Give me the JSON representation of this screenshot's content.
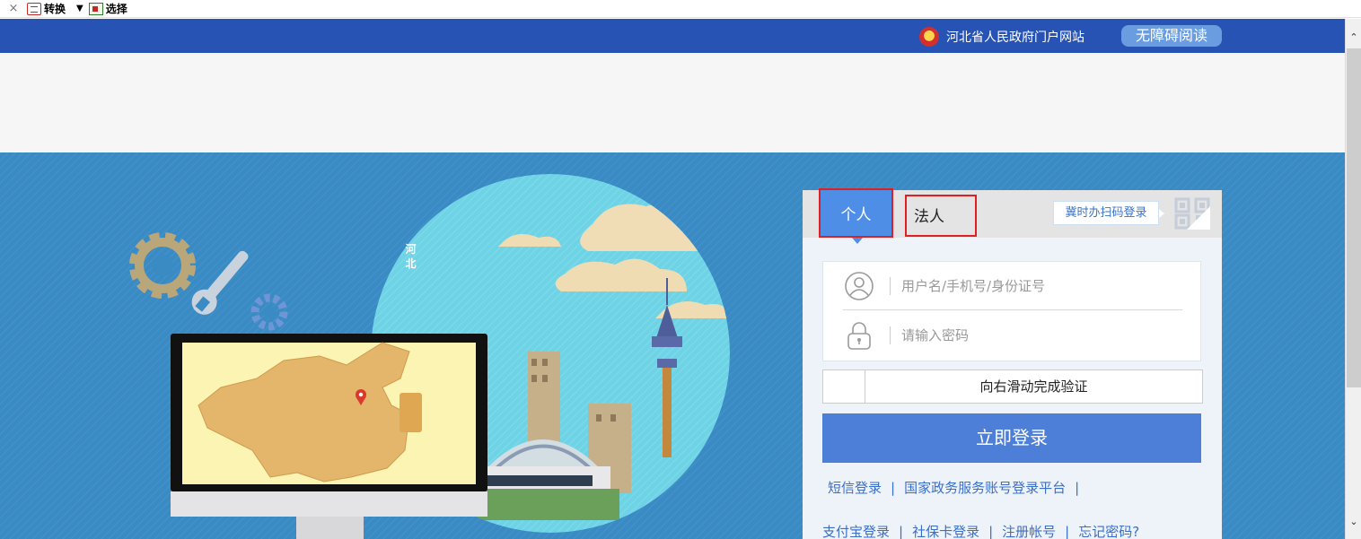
{
  "toolbar": {
    "close": "×",
    "convert_label": "转换",
    "dropdown": "▼",
    "select_label": "选择"
  },
  "header": {
    "gov_portal": "河北省人民政府门户网站",
    "accessible_read": "无障碍阅读"
  },
  "login": {
    "tab_personal": "个人",
    "tab_legal": "法人",
    "scan_login": "冀时办扫码登录",
    "username_placeholder": "用户名/手机号/身份证号",
    "password_placeholder": "请输入密码",
    "slider_text": "向右滑动完成验证",
    "login_button": "立即登录",
    "links_row1": [
      "短信登录",
      "国家政务服务账号登录平台"
    ],
    "links_row2": [
      "支付宝登录",
      "社保卡登录",
      "注册帐号",
      "忘记密码?"
    ],
    "separator": "|"
  },
  "illustration": {
    "province_label": "河北"
  },
  "colors": {
    "header_blue": "#2753b5",
    "hero_blue": "#3a8ac4",
    "login_button": "#4e7fd8",
    "tab_active": "#4e8ee6",
    "highlight_red": "#e02020"
  }
}
